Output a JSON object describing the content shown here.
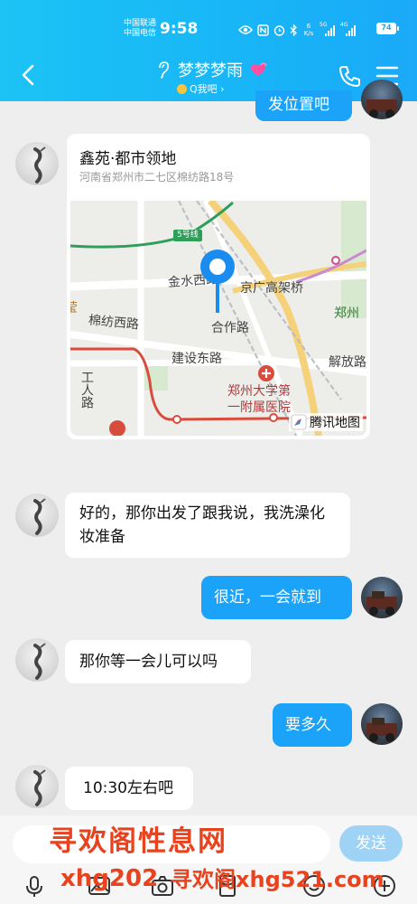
{
  "status_bar": {
    "carrier_1": "中国联通",
    "carrier_2": "中国电信",
    "time": "9:58",
    "net_speed_value": "6",
    "net_speed_unit": "K/s",
    "signal_1": "5G",
    "signal_2": "4G",
    "battery": "74"
  },
  "header": {
    "title": "梦梦梦雨",
    "subtitle": "Q我吧 ›"
  },
  "messages": {
    "partial_sent": "发位置吧",
    "location": {
      "name": "鑫苑·都市领地",
      "address": "河南省郑州市二七区棉纺路18号",
      "map": {
        "metro_line": "5号线",
        "road_jinshui": "金水西路",
        "bridge_jingguang": "京广高架桥",
        "road_mianfang": "棉纺西路",
        "road_hezuo": "合作路",
        "district_zhengzhou": "郑州",
        "road_jianshe": "建设东路",
        "road_jiefang": "解放路",
        "hospital_line1": "郑州大学第",
        "hospital_line2": "一附属医院",
        "road_gongren": "工人路",
        "char_ying": "莹",
        "provider": "腾讯地图"
      }
    },
    "m1": "好的，那你出发了跟我说，我洗澡化妆准备",
    "m2": "很近，一会就到",
    "m3": "那你等一会儿可以吗",
    "m4": "要多久",
    "m5": "10:30左右吧"
  },
  "input": {
    "placeholder": "",
    "send_label": "发送"
  },
  "toolbar_icons": [
    "mic-icon",
    "image-icon",
    "camera-icon",
    "red-packet-icon",
    "emoji-icon",
    "plus-icon"
  ],
  "watermarks": {
    "line1": "寻欢阁性息网",
    "line2": "xhg202",
    "line3": "寻欢阁xhg521.com"
  },
  "colors": {
    "header": "#1ab5f7",
    "sent_bubble": "#1aa3f8",
    "send_button": "#9fd3f6",
    "watermark": "#e8431e"
  }
}
